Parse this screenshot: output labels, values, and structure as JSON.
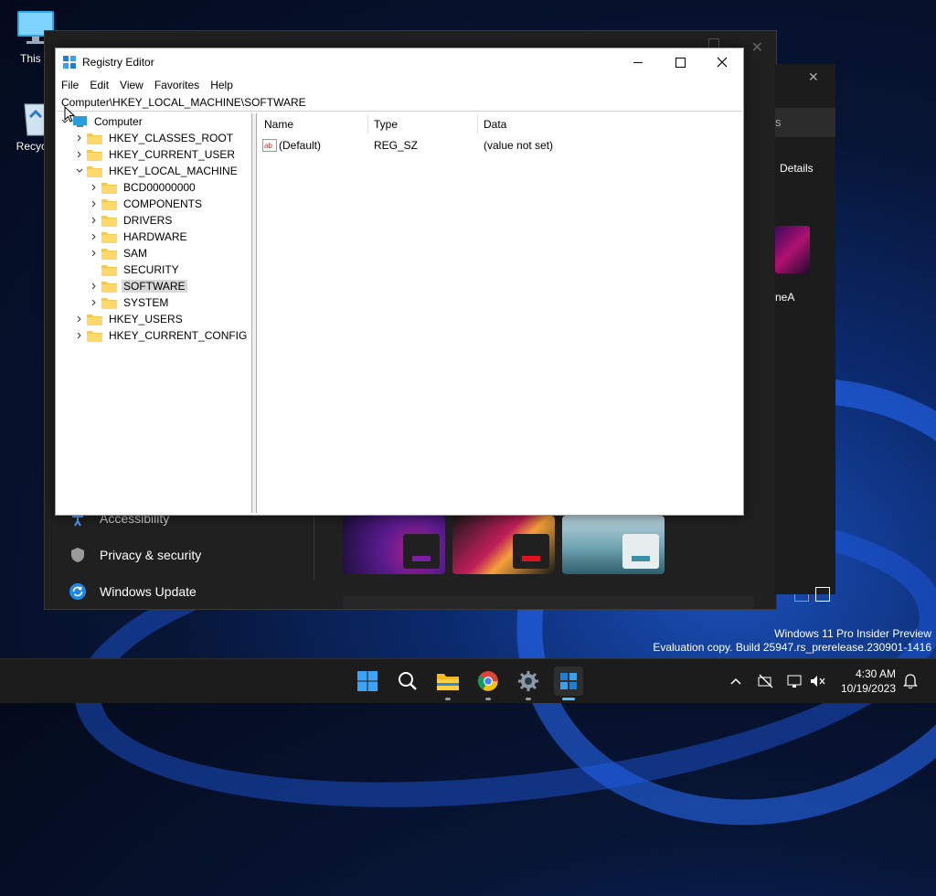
{
  "desktop": {
    "icons": [
      {
        "label": "This P"
      },
      {
        "label": "Recycle"
      }
    ],
    "watermark": {
      "line1": "Windows 11 Pro Insider Preview",
      "line2": "Evaluation copy. Build 25947.rs_prerelease.230901-1416"
    }
  },
  "settings_window": {
    "nav": [
      {
        "label": "Accessibility",
        "icon": "accessibility-icon"
      },
      {
        "label": "Privacy & security",
        "icon": "shield-icon"
      },
      {
        "label": "Windows Update",
        "icon": "update-icon"
      }
    ],
    "right_fragments": {
      "s_fragment": "s",
      "details": "Details",
      "theme_fragment": "neA"
    }
  },
  "registry": {
    "title": "Registry Editor",
    "menu": [
      "File",
      "Edit",
      "View",
      "Favorites",
      "Help"
    ],
    "address": "Computer\\HKEY_LOCAL_MACHINE\\SOFTWARE",
    "tree": [
      {
        "label": "Computer"
      },
      {
        "label": "HKEY_CLASSES_ROOT"
      },
      {
        "label": "HKEY_CURRENT_USER"
      },
      {
        "label": "HKEY_LOCAL_MACHINE"
      },
      {
        "label": "BCD00000000"
      },
      {
        "label": "COMPONENTS"
      },
      {
        "label": "DRIVERS"
      },
      {
        "label": "HARDWARE"
      },
      {
        "label": "SAM"
      },
      {
        "label": "SECURITY"
      },
      {
        "label": "SOFTWARE"
      },
      {
        "label": "SYSTEM"
      },
      {
        "label": "HKEY_USERS"
      },
      {
        "label": "HKEY_CURRENT_CONFIG"
      }
    ],
    "columns": [
      "Name",
      "Type",
      "Data"
    ],
    "values": [
      {
        "name": "(Default)",
        "type": "REG_SZ",
        "data": "(value not set)"
      }
    ]
  },
  "taskbar": {
    "apps": [
      "start-icon",
      "search-icon",
      "file-explorer-icon",
      "chrome-icon",
      "settings-icon",
      "registry-editor-icon"
    ],
    "clock": {
      "time": "4:30 AM",
      "date": "10/19/2023"
    }
  }
}
